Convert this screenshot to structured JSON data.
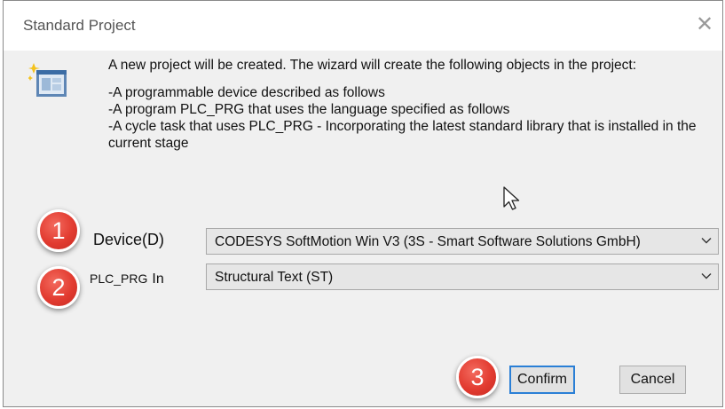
{
  "window": {
    "title": "Standard Project",
    "close_glyph": "✕"
  },
  "description": {
    "intro": "A new project will be created. The wizard will create the following objects in the project:",
    "lines": [
      "-A programmable device described as follows",
      "-A program PLC_PRG that uses the language specified as follows",
      "-A cycle task that uses PLC_PRG - Incorporating the latest standard library that is installed in the current stage"
    ]
  },
  "form": {
    "device_label": "Device(D)",
    "device_value": "CODESYS SoftMotion Win V3 (3S - Smart Software Solutions GmbH)",
    "plc_label_small": "PLC_PRG",
    "plc_label_big": "In",
    "plc_value": "Structural Text (ST)"
  },
  "buttons": {
    "confirm": "Confirm",
    "cancel": "Cancel"
  },
  "annotations": {
    "badge1": "1",
    "badge2": "2",
    "badge3": "3"
  },
  "colors": {
    "badge": "#e23b30",
    "focus_border": "#2a7fd6",
    "dialog_bg": "#f0f0f0"
  },
  "icons": {
    "wizard": "project-wizard-icon",
    "cursor": "mouse-pointer-icon",
    "dropdown": "chevron-down-icon"
  }
}
